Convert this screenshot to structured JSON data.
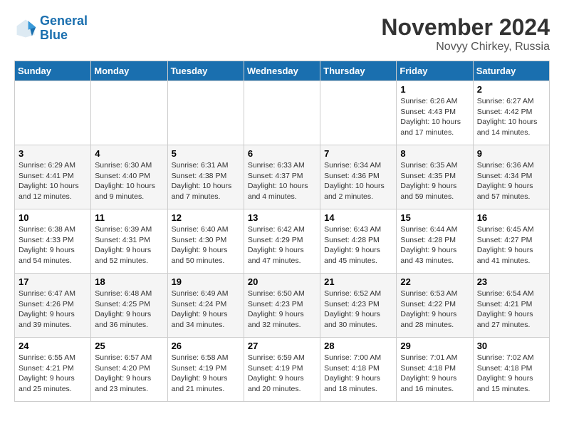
{
  "logo": {
    "line1": "General",
    "line2": "Blue"
  },
  "title": "November 2024",
  "location": "Novyy Chirkey, Russia",
  "weekdays": [
    "Sunday",
    "Monday",
    "Tuesday",
    "Wednesday",
    "Thursday",
    "Friday",
    "Saturday"
  ],
  "weeks": [
    [
      {
        "day": "",
        "info": ""
      },
      {
        "day": "",
        "info": ""
      },
      {
        "day": "",
        "info": ""
      },
      {
        "day": "",
        "info": ""
      },
      {
        "day": "",
        "info": ""
      },
      {
        "day": "1",
        "info": "Sunrise: 6:26 AM\nSunset: 4:43 PM\nDaylight: 10 hours and 17 minutes."
      },
      {
        "day": "2",
        "info": "Sunrise: 6:27 AM\nSunset: 4:42 PM\nDaylight: 10 hours and 14 minutes."
      }
    ],
    [
      {
        "day": "3",
        "info": "Sunrise: 6:29 AM\nSunset: 4:41 PM\nDaylight: 10 hours and 12 minutes."
      },
      {
        "day": "4",
        "info": "Sunrise: 6:30 AM\nSunset: 4:40 PM\nDaylight: 10 hours and 9 minutes."
      },
      {
        "day": "5",
        "info": "Sunrise: 6:31 AM\nSunset: 4:38 PM\nDaylight: 10 hours and 7 minutes."
      },
      {
        "day": "6",
        "info": "Sunrise: 6:33 AM\nSunset: 4:37 PM\nDaylight: 10 hours and 4 minutes."
      },
      {
        "day": "7",
        "info": "Sunrise: 6:34 AM\nSunset: 4:36 PM\nDaylight: 10 hours and 2 minutes."
      },
      {
        "day": "8",
        "info": "Sunrise: 6:35 AM\nSunset: 4:35 PM\nDaylight: 9 hours and 59 minutes."
      },
      {
        "day": "9",
        "info": "Sunrise: 6:36 AM\nSunset: 4:34 PM\nDaylight: 9 hours and 57 minutes."
      }
    ],
    [
      {
        "day": "10",
        "info": "Sunrise: 6:38 AM\nSunset: 4:33 PM\nDaylight: 9 hours and 54 minutes."
      },
      {
        "day": "11",
        "info": "Sunrise: 6:39 AM\nSunset: 4:31 PM\nDaylight: 9 hours and 52 minutes."
      },
      {
        "day": "12",
        "info": "Sunrise: 6:40 AM\nSunset: 4:30 PM\nDaylight: 9 hours and 50 minutes."
      },
      {
        "day": "13",
        "info": "Sunrise: 6:42 AM\nSunset: 4:29 PM\nDaylight: 9 hours and 47 minutes."
      },
      {
        "day": "14",
        "info": "Sunrise: 6:43 AM\nSunset: 4:28 PM\nDaylight: 9 hours and 45 minutes."
      },
      {
        "day": "15",
        "info": "Sunrise: 6:44 AM\nSunset: 4:28 PM\nDaylight: 9 hours and 43 minutes."
      },
      {
        "day": "16",
        "info": "Sunrise: 6:45 AM\nSunset: 4:27 PM\nDaylight: 9 hours and 41 minutes."
      }
    ],
    [
      {
        "day": "17",
        "info": "Sunrise: 6:47 AM\nSunset: 4:26 PM\nDaylight: 9 hours and 39 minutes."
      },
      {
        "day": "18",
        "info": "Sunrise: 6:48 AM\nSunset: 4:25 PM\nDaylight: 9 hours and 36 minutes."
      },
      {
        "day": "19",
        "info": "Sunrise: 6:49 AM\nSunset: 4:24 PM\nDaylight: 9 hours and 34 minutes."
      },
      {
        "day": "20",
        "info": "Sunrise: 6:50 AM\nSunset: 4:23 PM\nDaylight: 9 hours and 32 minutes."
      },
      {
        "day": "21",
        "info": "Sunrise: 6:52 AM\nSunset: 4:23 PM\nDaylight: 9 hours and 30 minutes."
      },
      {
        "day": "22",
        "info": "Sunrise: 6:53 AM\nSunset: 4:22 PM\nDaylight: 9 hours and 28 minutes."
      },
      {
        "day": "23",
        "info": "Sunrise: 6:54 AM\nSunset: 4:21 PM\nDaylight: 9 hours and 27 minutes."
      }
    ],
    [
      {
        "day": "24",
        "info": "Sunrise: 6:55 AM\nSunset: 4:21 PM\nDaylight: 9 hours and 25 minutes."
      },
      {
        "day": "25",
        "info": "Sunrise: 6:57 AM\nSunset: 4:20 PM\nDaylight: 9 hours and 23 minutes."
      },
      {
        "day": "26",
        "info": "Sunrise: 6:58 AM\nSunset: 4:19 PM\nDaylight: 9 hours and 21 minutes."
      },
      {
        "day": "27",
        "info": "Sunrise: 6:59 AM\nSunset: 4:19 PM\nDaylight: 9 hours and 20 minutes."
      },
      {
        "day": "28",
        "info": "Sunrise: 7:00 AM\nSunset: 4:18 PM\nDaylight: 9 hours and 18 minutes."
      },
      {
        "day": "29",
        "info": "Sunrise: 7:01 AM\nSunset: 4:18 PM\nDaylight: 9 hours and 16 minutes."
      },
      {
        "day": "30",
        "info": "Sunrise: 7:02 AM\nSunset: 4:18 PM\nDaylight: 9 hours and 15 minutes."
      }
    ]
  ]
}
